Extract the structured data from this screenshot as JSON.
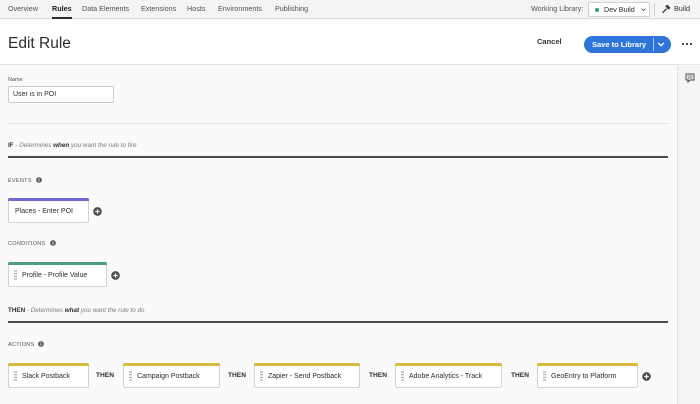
{
  "nav": {
    "tabs": [
      {
        "label": "Overview",
        "active": false
      },
      {
        "label": "Rules",
        "active": true
      },
      {
        "label": "Data Elements",
        "active": false
      },
      {
        "label": "Extensions",
        "active": false
      },
      {
        "label": "Hosts",
        "active": false
      },
      {
        "label": "Environments",
        "active": false
      },
      {
        "label": "Publishing",
        "active": false
      }
    ],
    "working_library_label": "Working Library:",
    "library_value": "Dev Build",
    "library_status_color": "#2d9d78",
    "build_label": "Build"
  },
  "header": {
    "title": "Edit Rule",
    "cancel_label": "Cancel",
    "save_label": "Save to Library",
    "accent": "#2f74d8"
  },
  "form": {
    "name_label": "Name",
    "name_value": "User is in POI"
  },
  "if_section": {
    "prefix": "IF",
    "text_a": " - Determines ",
    "emph": "when",
    "text_b": " you want the rule to fire"
  },
  "events": {
    "label": "EVENTS",
    "items": [
      {
        "label": "Places - Enter POI",
        "color": "#6e6ad2"
      }
    ]
  },
  "conditions": {
    "label": "CONDITIONS",
    "items": [
      {
        "label": "Profile - Profile Value",
        "color": "#4a9f7f"
      }
    ]
  },
  "then_section": {
    "prefix": "THEN",
    "text_a": " - Determines ",
    "emph": "what",
    "text_b": " you want the rule to do"
  },
  "actions": {
    "label": "ACTIONS",
    "connector": "THEN",
    "color": "#d9b93d",
    "items": [
      {
        "label": "Slack Postback"
      },
      {
        "label": "Campaign Postback"
      },
      {
        "label": "Zapier - Send Postback"
      },
      {
        "label": "Adobe Analytics - Track"
      },
      {
        "label": "GeoEntry to Platform"
      }
    ]
  },
  "icons": {
    "library_chevron": "chevron-down-icon",
    "build": "hammer-icon",
    "save_split": "chevron-down-icon",
    "more": "more-icon",
    "rail": "comment-icon",
    "info": "info-icon",
    "add": "add-circle-icon",
    "drag": "drag-handle-icon"
  }
}
